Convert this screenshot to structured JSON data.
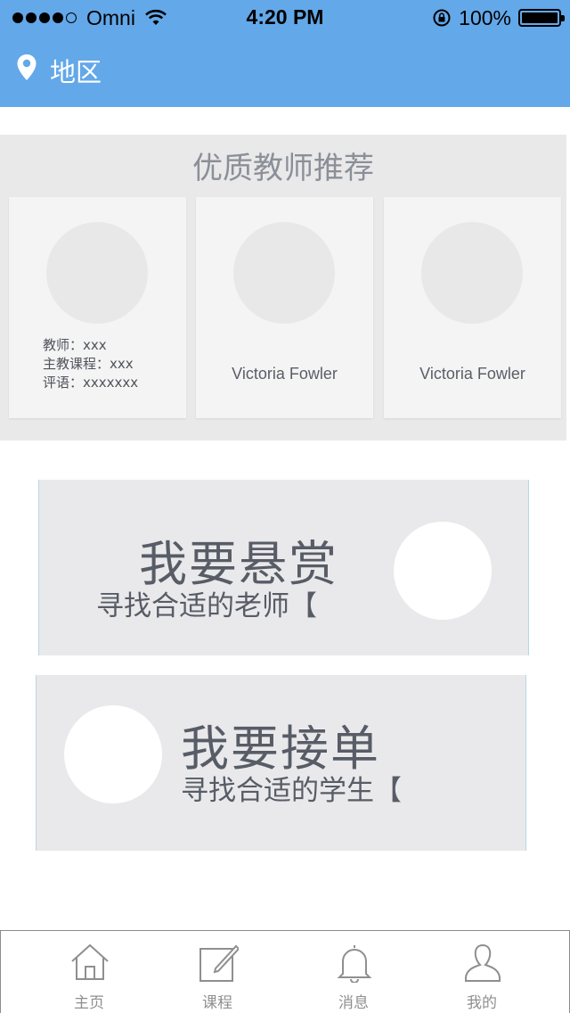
{
  "status_bar": {
    "carrier": "Omni",
    "time": "4:20 PM",
    "battery": "100%"
  },
  "nav": {
    "title": "地区"
  },
  "recommend": {
    "title": "优质教师推荐",
    "cards": [
      {
        "teacher": "教师：xxx",
        "course": "主教课程：xxx",
        "comment": "评语：xxxxxxx"
      },
      {
        "name": "Victoria Fowler"
      },
      {
        "name": "Victoria Fowler"
      }
    ]
  },
  "actions": {
    "reward": {
      "title": "我要悬赏",
      "subtitle": "寻找合适的老师【"
    },
    "accept": {
      "title": "我要接单",
      "subtitle": "寻找合适的学生【"
    }
  },
  "tabs": [
    {
      "label": "主页",
      "icon": "home-icon"
    },
    {
      "label": "课程",
      "icon": "edit-icon"
    },
    {
      "label": "消息",
      "icon": "bell-icon"
    },
    {
      "label": "我的",
      "icon": "user-icon"
    }
  ],
  "colors": {
    "header": "#63a8e9",
    "section_bg": "#e9e9ea",
    "text_dark": "#575c66"
  }
}
